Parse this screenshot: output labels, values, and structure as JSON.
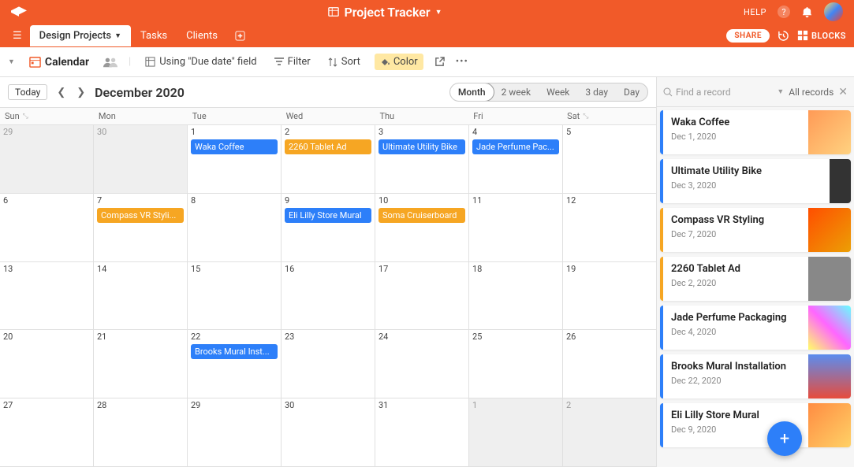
{
  "topbar": {
    "title": "Project Tracker",
    "help": "HELP"
  },
  "tabs": {
    "items": [
      "Design Projects",
      "Tasks",
      "Clients"
    ],
    "active": 0
  },
  "share": "SHARE",
  "blocks": "BLOCKS",
  "toolbar": {
    "view": "Calendar",
    "using": "Using \"Due date\" field",
    "filter": "Filter",
    "sort": "Sort",
    "color": "Color"
  },
  "calendar": {
    "today": "Today",
    "title": "December 2020",
    "views": [
      "Month",
      "2 week",
      "Week",
      "3 day",
      "Day"
    ],
    "active_view": 0,
    "days": [
      "Sun",
      "Mon",
      "Tue",
      "Wed",
      "Thu",
      "Fri",
      "Sat"
    ],
    "weeks": [
      [
        {
          "n": "29",
          "dim": true
        },
        {
          "n": "30",
          "dim": true
        },
        {
          "n": "1",
          "ev": [
            {
              "t": "Waka Coffee",
              "c": "blue"
            }
          ]
        },
        {
          "n": "2",
          "ev": [
            {
              "t": "2260 Tablet Ad",
              "c": "orange"
            }
          ]
        },
        {
          "n": "3",
          "ev": [
            {
              "t": "Ultimate Utility Bike",
              "c": "blue"
            }
          ]
        },
        {
          "n": "4",
          "ev": [
            {
              "t": "Jade Perfume Pac...",
              "c": "blue"
            }
          ]
        },
        {
          "n": "5"
        }
      ],
      [
        {
          "n": "6"
        },
        {
          "n": "7",
          "ev": [
            {
              "t": "Compass VR Styli...",
              "c": "orange"
            }
          ]
        },
        {
          "n": "8"
        },
        {
          "n": "9",
          "ev": [
            {
              "t": "Eli Lilly Store Mural",
              "c": "blue"
            }
          ]
        },
        {
          "n": "10",
          "ev": [
            {
              "t": "Soma Cruiserboard",
              "c": "orange"
            }
          ]
        },
        {
          "n": "11"
        },
        {
          "n": "12"
        }
      ],
      [
        {
          "n": "13"
        },
        {
          "n": "14"
        },
        {
          "n": "15"
        },
        {
          "n": "16"
        },
        {
          "n": "17"
        },
        {
          "n": "18"
        },
        {
          "n": "19"
        }
      ],
      [
        {
          "n": "20"
        },
        {
          "n": "21"
        },
        {
          "n": "22",
          "ev": [
            {
              "t": "Brooks Mural Inst...",
              "c": "blue"
            }
          ]
        },
        {
          "n": "23"
        },
        {
          "n": "24"
        },
        {
          "n": "25"
        },
        {
          "n": "26"
        }
      ],
      [
        {
          "n": "27"
        },
        {
          "n": "28"
        },
        {
          "n": "29"
        },
        {
          "n": "30"
        },
        {
          "n": "31"
        },
        {
          "n": "1",
          "dim": true
        },
        {
          "n": "2",
          "dim": true
        }
      ]
    ]
  },
  "sidebar": {
    "placeholder": "Find a record",
    "all": "All records",
    "records": [
      {
        "name": "Waka Coffee",
        "date": "Dec 1, 2020",
        "bar": "blue",
        "th": "t1"
      },
      {
        "name": "Ultimate Utility Bike",
        "date": "Dec 3, 2020",
        "bar": "blue",
        "th": "t2"
      },
      {
        "name": "Compass VR Styling",
        "date": "Dec 7, 2020",
        "bar": "orange",
        "th": "t3"
      },
      {
        "name": "2260 Tablet Ad",
        "date": "Dec 2, 2020",
        "bar": "orange",
        "th": "t4"
      },
      {
        "name": "Jade Perfume Packaging",
        "date": "Dec 4, 2020",
        "bar": "blue",
        "th": "t5"
      },
      {
        "name": "Brooks Mural Installation",
        "date": "Dec 22, 2020",
        "bar": "blue",
        "th": "t6"
      },
      {
        "name": "Eli Lilly Store Mural",
        "date": "Dec 9, 2020",
        "bar": "blue",
        "th": "t7"
      }
    ]
  }
}
